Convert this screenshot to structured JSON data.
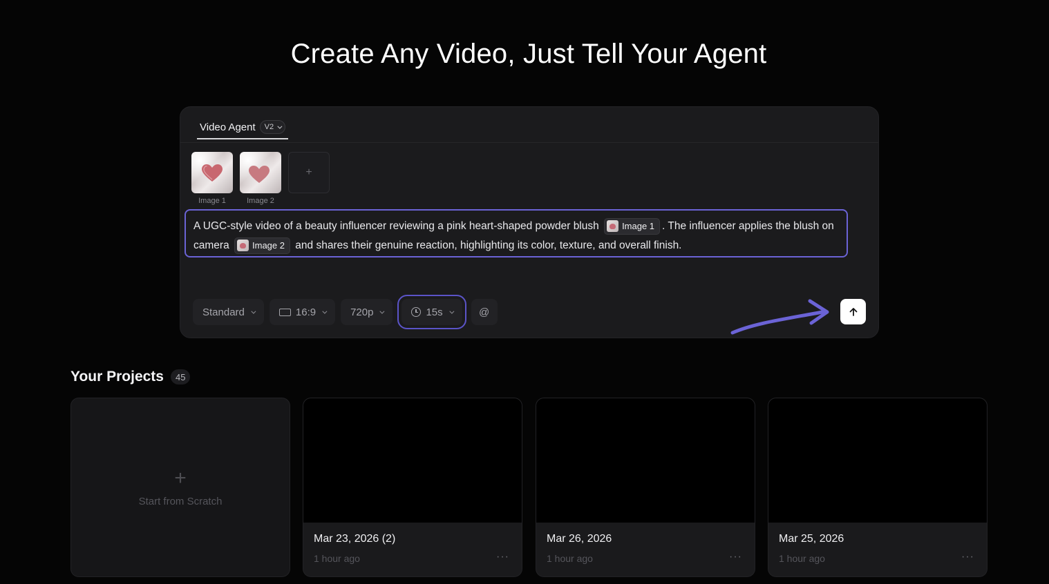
{
  "headline": "Create Any Video, Just Tell Your Agent",
  "composer": {
    "tab_label": "Video Agent",
    "version": "V2",
    "images": [
      {
        "caption": "Image 1"
      },
      {
        "caption": "Image 2"
      }
    ],
    "add_image_icon": "plus-icon",
    "prompt": {
      "segment_1": "A UGC-style video of a beauty influencer reviewing a pink heart-shaped powder blush",
      "chip_1": "Image 1",
      "segment_2": ". The influencer applies the blush on camera",
      "chip_2": "Image 2",
      "segment_3": "and shares their genuine reaction, highlighting its color, texture, and overall finish."
    },
    "controls": {
      "quality": "Standard",
      "aspect_ratio": "16:9",
      "resolution": "720p",
      "duration": "15s",
      "mention": "@"
    },
    "send_icon": "arrow-up-icon",
    "accent_color": "#6b63d6"
  },
  "projects": {
    "title": "Your Projects",
    "count": "45",
    "new_card_label": "Start from Scratch",
    "items": [
      {
        "title": "Mar 23, 2026 (2)",
        "time": "1 hour ago",
        "more": "···"
      },
      {
        "title": "Mar 26, 2026",
        "time": "1 hour ago",
        "more": "···"
      },
      {
        "title": "Mar 25, 2026",
        "time": "1 hour ago",
        "more": "···"
      }
    ]
  }
}
